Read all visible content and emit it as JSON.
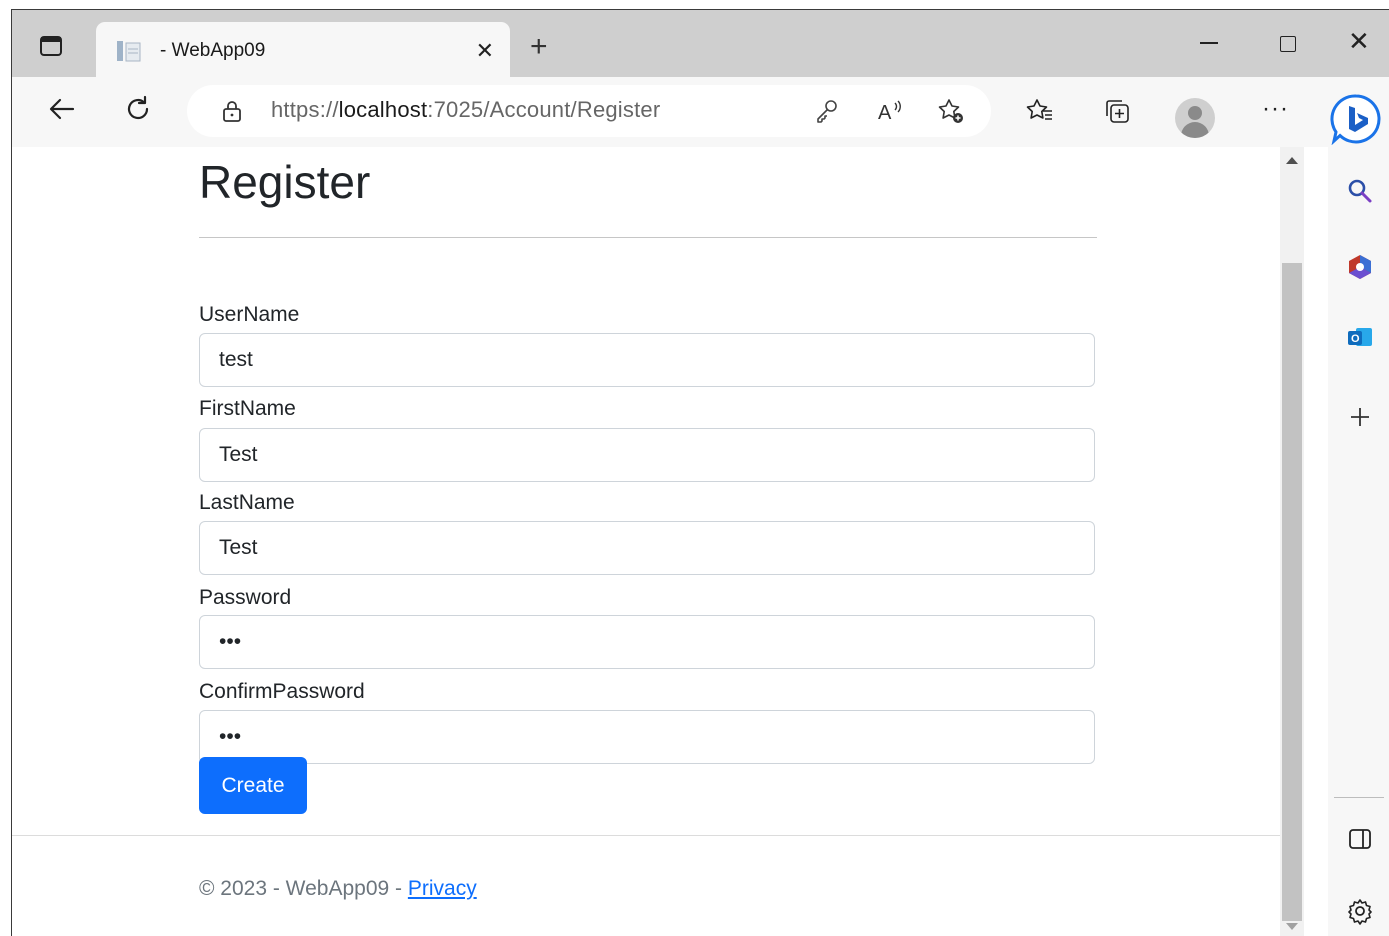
{
  "browser": {
    "tab_title": "- WebApp09",
    "tab_close": "✕",
    "new_tab": "+",
    "window_close": "✕",
    "url_prefix": "https://",
    "url_host": "localhost",
    "url_rest": ":7025/Account/Register",
    "more": "···"
  },
  "page": {
    "title": "Register",
    "fields": [
      {
        "label": "UserName",
        "value": "test"
      },
      {
        "label": "FirstName",
        "value": "Test"
      },
      {
        "label": "LastName",
        "value": "Test"
      },
      {
        "label": "Password",
        "value": "•••"
      },
      {
        "label": "ConfirmPassword",
        "value": "•••"
      }
    ],
    "submit_label": "Create",
    "footer_text": "© 2023 - WebApp09 - ",
    "footer_link": "Privacy"
  },
  "colors": {
    "accent": "#0d6efd",
    "titlebar": "#cfcfcf",
    "toolbar": "#f7f7f7"
  },
  "icons": [
    "tab-actions-icon",
    "page-favicon-icon",
    "close-icon",
    "back-arrow-icon",
    "refresh-icon",
    "lock-icon",
    "key-icon",
    "read-aloud-icon",
    "add-favorite-icon",
    "favorites-icon",
    "collections-icon",
    "profile-avatar",
    "bing-chat-icon",
    "search-icon",
    "office-icon",
    "outlook-icon",
    "add-icon",
    "sidebar-toggle-icon",
    "settings-gear-icon"
  ]
}
